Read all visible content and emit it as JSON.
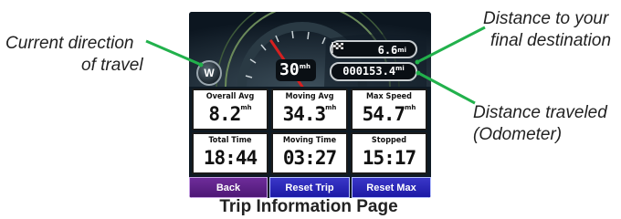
{
  "callouts": {
    "direction": {
      "line1": "Current direction",
      "line2": "of travel"
    },
    "destination": {
      "line1": "Distance to your",
      "line2": "final destination"
    },
    "odometer": {
      "line1": "Distance traveled",
      "line2": "(Odometer)"
    }
  },
  "device": {
    "compass_heading": "W",
    "speed": {
      "value": "30",
      "unit": "mh"
    },
    "distance_to_destination": {
      "value": "6.6",
      "unit": "mi"
    },
    "odometer": {
      "value": "000153.4",
      "unit": "mi"
    },
    "tiles": [
      {
        "label": "Overall Avg",
        "value": "8.2",
        "unit": "mh"
      },
      {
        "label": "Moving Avg",
        "value": "34.3",
        "unit": "mh"
      },
      {
        "label": "Max Speed",
        "value": "54.7",
        "unit": "mh"
      },
      {
        "label": "Total Time",
        "value": "18:44",
        "unit": ""
      },
      {
        "label": "Moving Time",
        "value": "03:27",
        "unit": ""
      },
      {
        "label": "Stopped",
        "value": "15:17",
        "unit": ""
      }
    ],
    "buttons": {
      "back": "Back",
      "reset_trip": "Reset Trip",
      "reset_max": "Reset Max"
    }
  },
  "caption": "Trip Information Page",
  "colors": {
    "callout_line": "#22b14c",
    "button_blue": "#2320b8",
    "button_purple": "#5c1f87",
    "gauge_arc": "#6b8a5a",
    "speedometer_needle": "#d62020"
  },
  "icons": {
    "destination": "checkered-flag-icon",
    "compass": "compass-icon"
  }
}
